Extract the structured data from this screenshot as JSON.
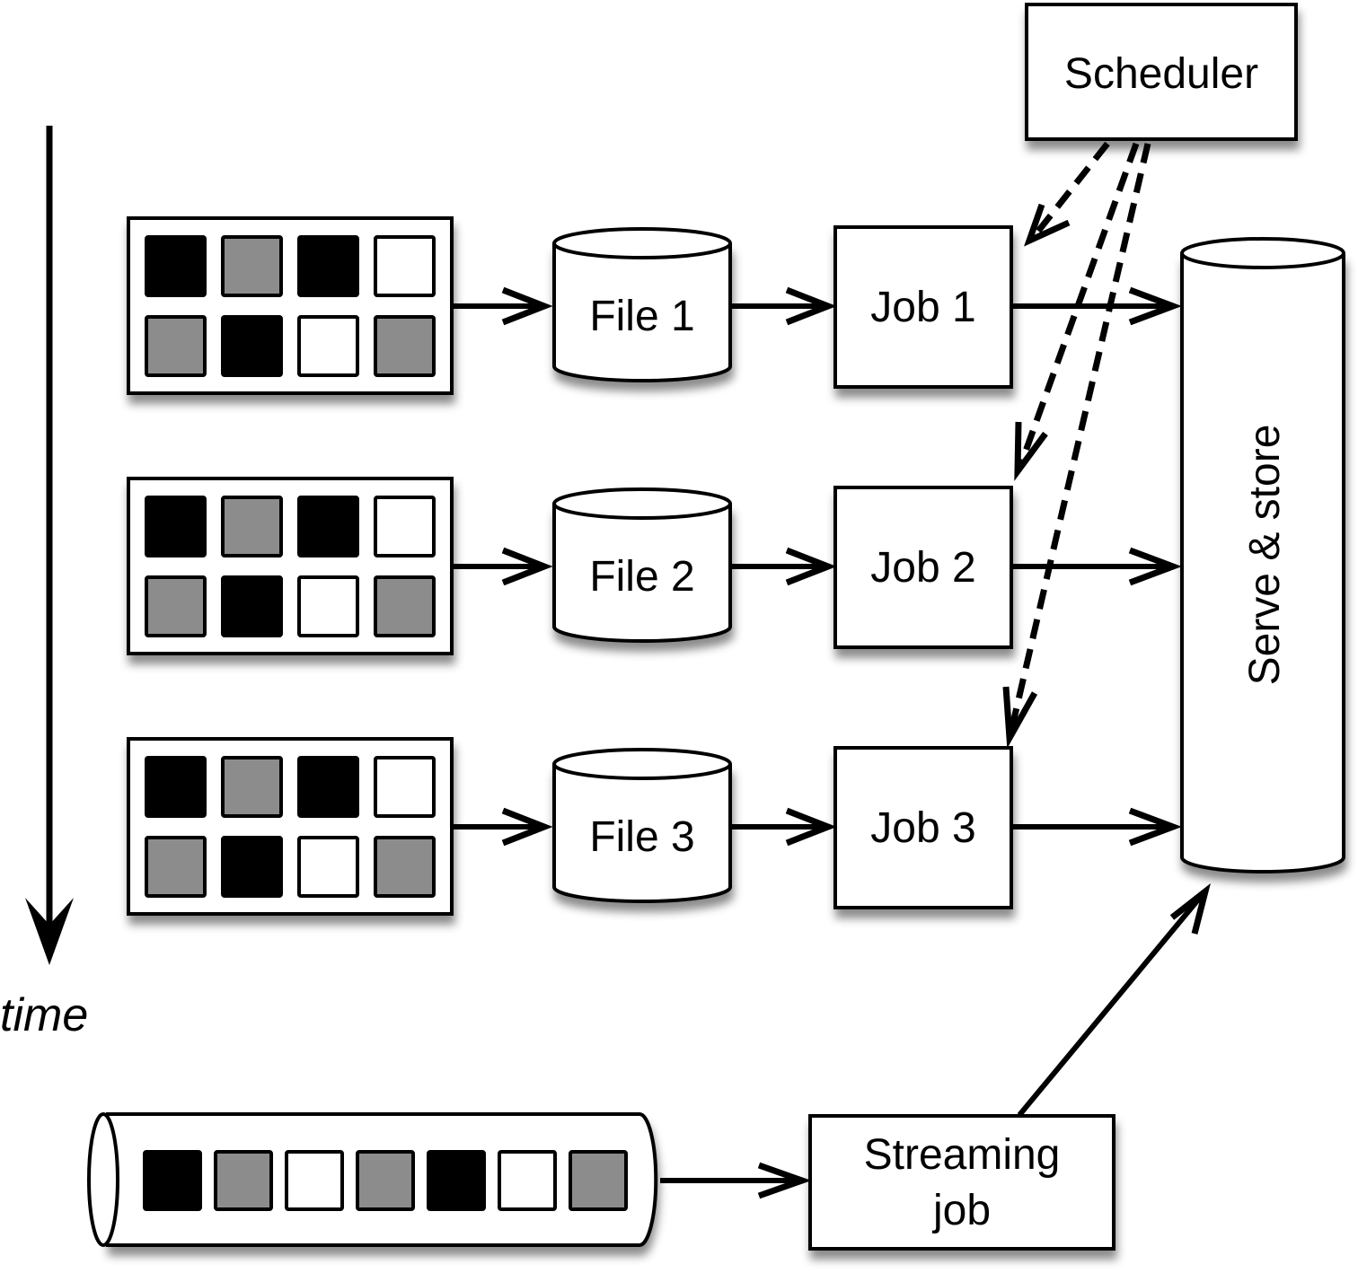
{
  "diagram": {
    "time_label": "time",
    "scheduler_label": "Scheduler",
    "store_label": "Serve & store",
    "streaming_job_label_line1": "Streaming",
    "streaming_job_label_line2": "job",
    "colors": {
      "black": "#000000",
      "gray": "#8c8c8c",
      "white": "#ffffff"
    },
    "batches": [
      {
        "grid": [
          [
            "black",
            "gray",
            "black",
            "white"
          ],
          [
            "gray",
            "black",
            "white",
            "gray"
          ]
        ],
        "file_label": "File 1",
        "job_label": "Job 1"
      },
      {
        "grid": [
          [
            "black",
            "gray",
            "black",
            "white"
          ],
          [
            "gray",
            "black",
            "white",
            "gray"
          ]
        ],
        "file_label": "File 2",
        "job_label": "Job 2"
      },
      {
        "grid": [
          [
            "black",
            "gray",
            "black",
            "white"
          ],
          [
            "gray",
            "black",
            "white",
            "gray"
          ]
        ],
        "file_label": "File 3",
        "job_label": "Job 3"
      }
    ],
    "stream_cells": [
      "black",
      "gray",
      "white",
      "gray",
      "black",
      "white",
      "gray"
    ]
  }
}
